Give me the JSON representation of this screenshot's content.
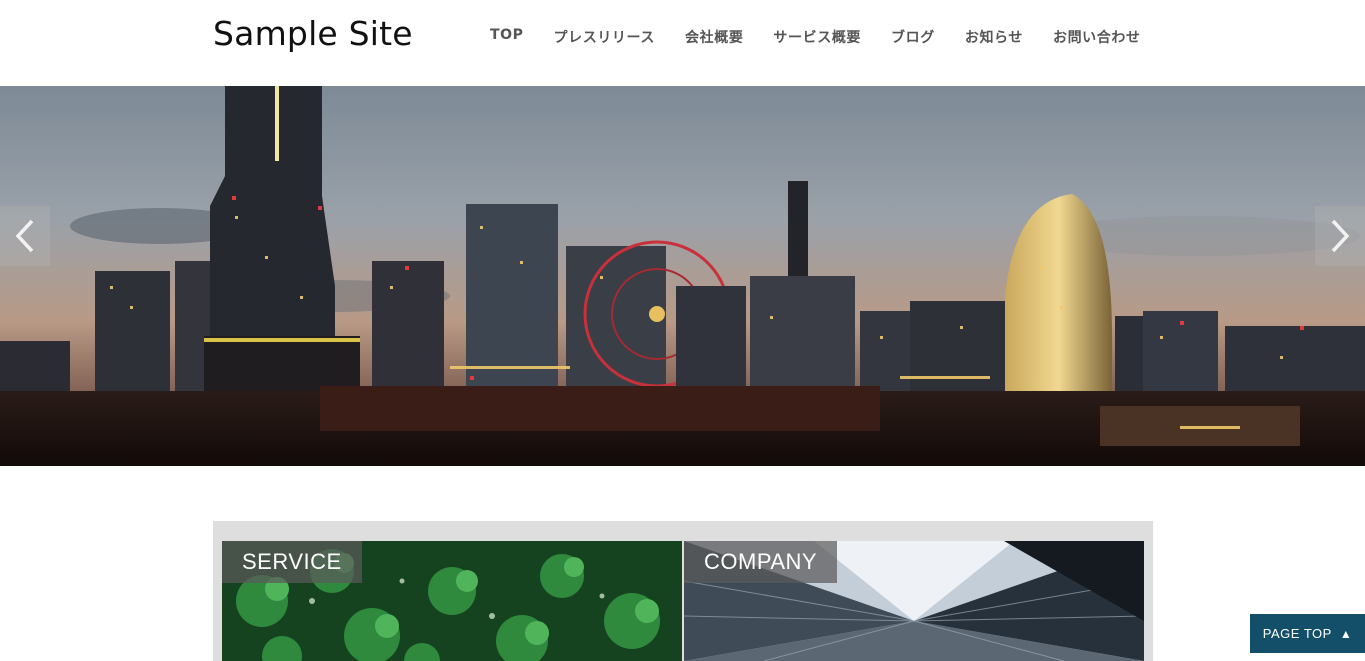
{
  "header": {
    "logo": "Sample Site",
    "nav": [
      "TOP",
      "プレスリリース",
      "会社概要",
      "サービス概要",
      "ブログ",
      "お知らせ",
      "お問い合わせ"
    ]
  },
  "hero": {
    "prev_icon": "chevron-left-icon",
    "next_icon": "chevron-right-icon"
  },
  "cards": {
    "service_label": "SERVICE",
    "company_label": "COMPANY"
  },
  "page_top": {
    "label": "PAGE TOP",
    "icon": "▲"
  },
  "colors": {
    "page_top_bg": "#144f6a",
    "card_frame_bg": "#dedede"
  }
}
